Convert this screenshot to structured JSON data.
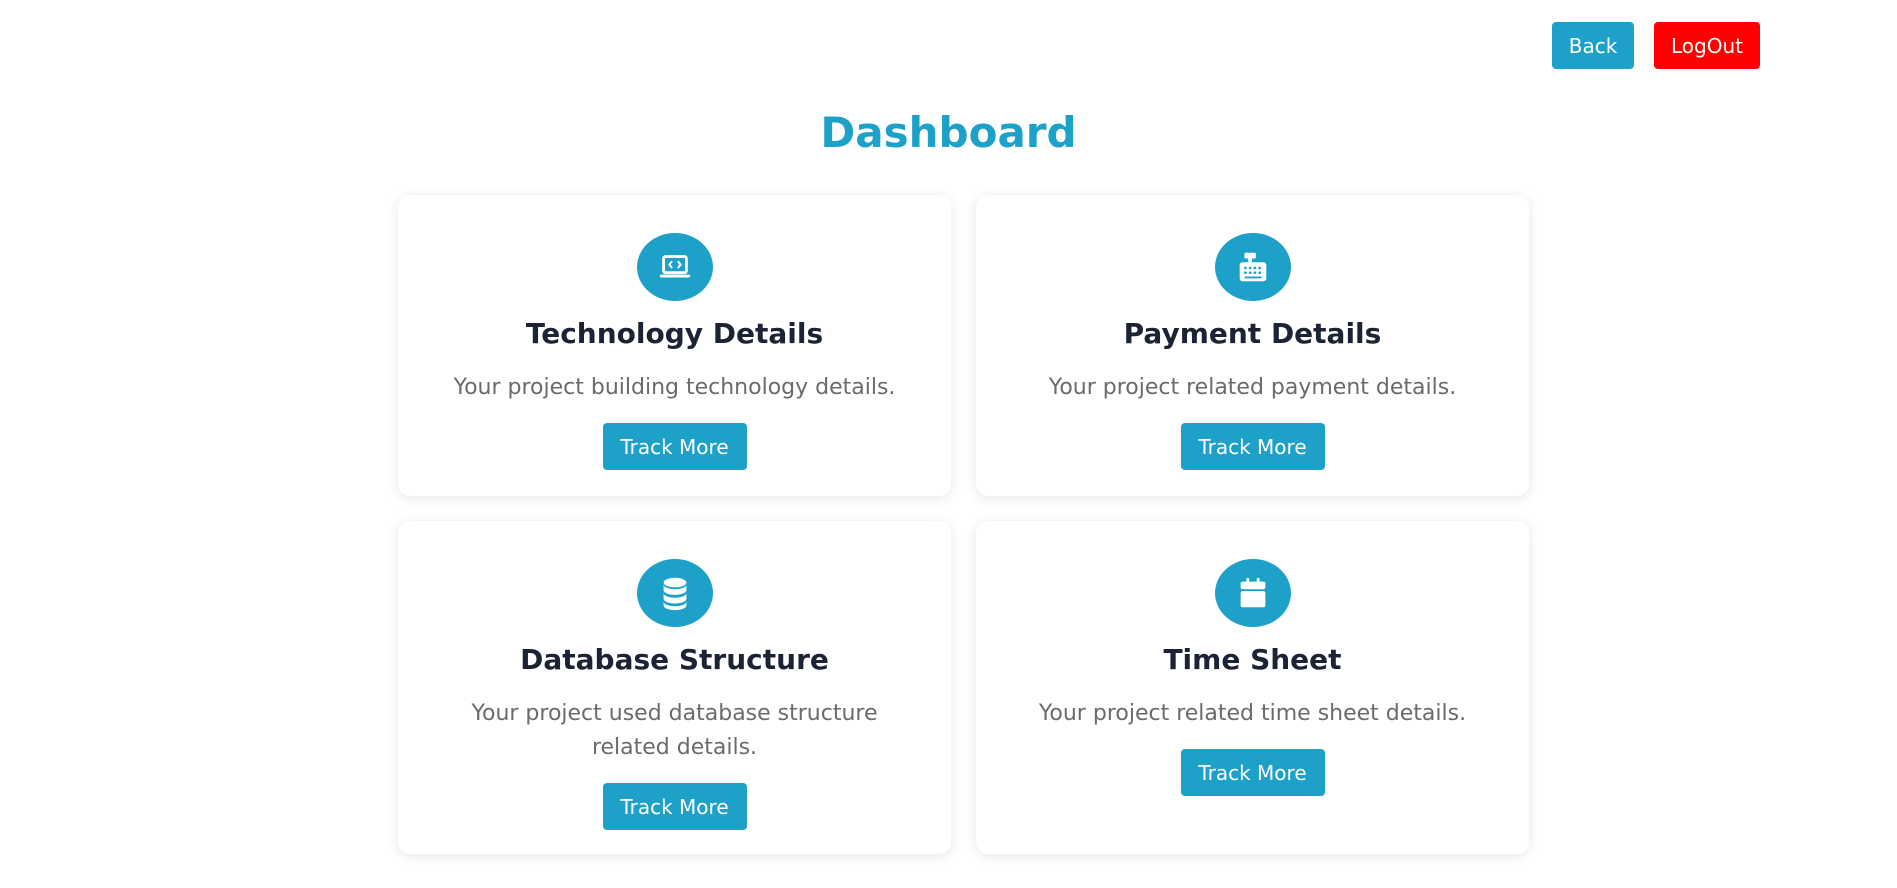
{
  "header": {
    "back_label": "Back",
    "logout_label": "LogOut"
  },
  "page": {
    "title": "Dashboard"
  },
  "cards": [
    {
      "icon": "laptop-code-icon",
      "title": "Technology Details",
      "description": "Your project building technology details.",
      "button_label": "Track More"
    },
    {
      "icon": "cash-register-icon",
      "title": "Payment Details",
      "description": "Your project related payment details.",
      "button_label": "Track More"
    },
    {
      "icon": "database-icon",
      "title": "Database Structure",
      "description": "Your project used database structure related details.",
      "button_label": "Track More"
    },
    {
      "icon": "calendar-icon",
      "title": "Time Sheet",
      "description": "Your project related time sheet details.",
      "button_label": "Track More"
    }
  ],
  "colors": {
    "accent": "#1da1c9",
    "logout": "#ff0000",
    "title_text": "#1c2334",
    "desc_text": "#6b6b6b"
  }
}
